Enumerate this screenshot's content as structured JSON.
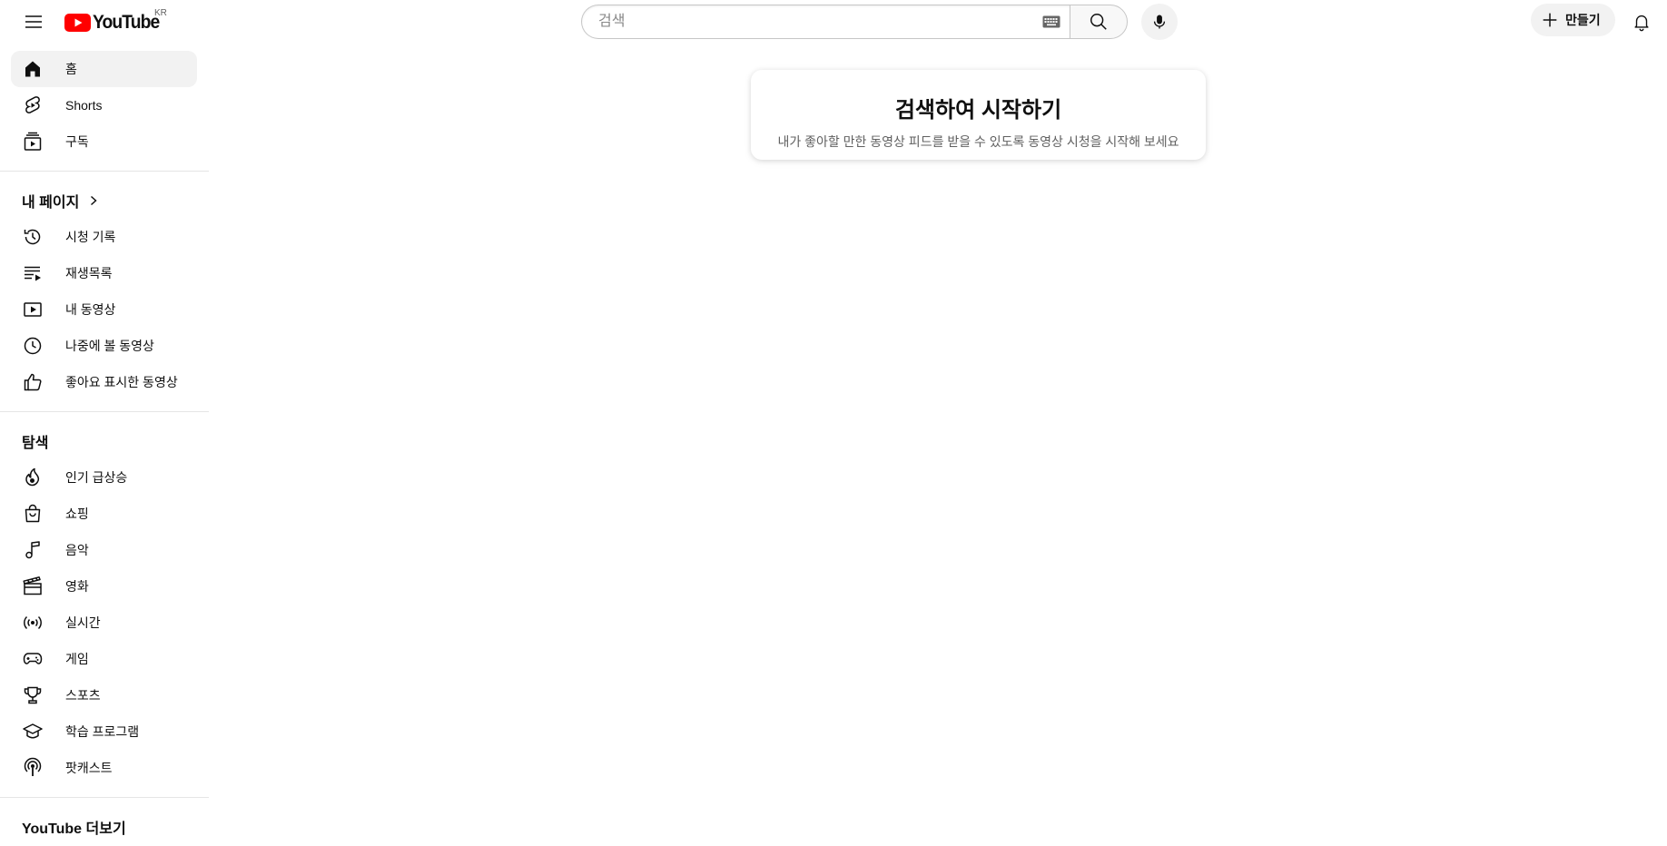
{
  "header": {
    "logo_text": "YouTube",
    "country_code": "KR",
    "search_placeholder": "검색",
    "create_label": "만들기"
  },
  "sidebar": {
    "primary": [
      {
        "label": "홈",
        "icon": "home-icon",
        "active": true
      },
      {
        "label": "Shorts",
        "icon": "shorts-icon"
      },
      {
        "label": "구독",
        "icon": "subscriptions-icon"
      }
    ],
    "my_page": {
      "heading": "내 페이지",
      "items": [
        {
          "label": "시청 기록",
          "icon": "history-icon"
        },
        {
          "label": "재생목록",
          "icon": "playlist-icon"
        },
        {
          "label": "내 동영상",
          "icon": "my-videos-icon"
        },
        {
          "label": "나중에 볼 동영상",
          "icon": "watch-later-icon"
        },
        {
          "label": "좋아요 표시한 동영상",
          "icon": "liked-icon"
        }
      ]
    },
    "explore": {
      "heading": "탐색",
      "items": [
        {
          "label": "인기 급상승",
          "icon": "trending-icon"
        },
        {
          "label": "쇼핑",
          "icon": "shopping-icon"
        },
        {
          "label": "음악",
          "icon": "music-icon"
        },
        {
          "label": "영화",
          "icon": "movies-icon"
        },
        {
          "label": "실시간",
          "icon": "live-icon"
        },
        {
          "label": "게임",
          "icon": "gaming-icon"
        },
        {
          "label": "스포츠",
          "icon": "sports-icon"
        },
        {
          "label": "학습 프로그램",
          "icon": "learning-icon"
        },
        {
          "label": "팟캐스트",
          "icon": "podcast-icon"
        }
      ]
    },
    "more_heading": "YouTube 더보기"
  },
  "main": {
    "card_title": "검색하여 시작하기",
    "card_subtitle": "내가 좋아할 만한 동영상 피드를 받을 수 있도록 동영상 시청을 시작해 보세요"
  }
}
